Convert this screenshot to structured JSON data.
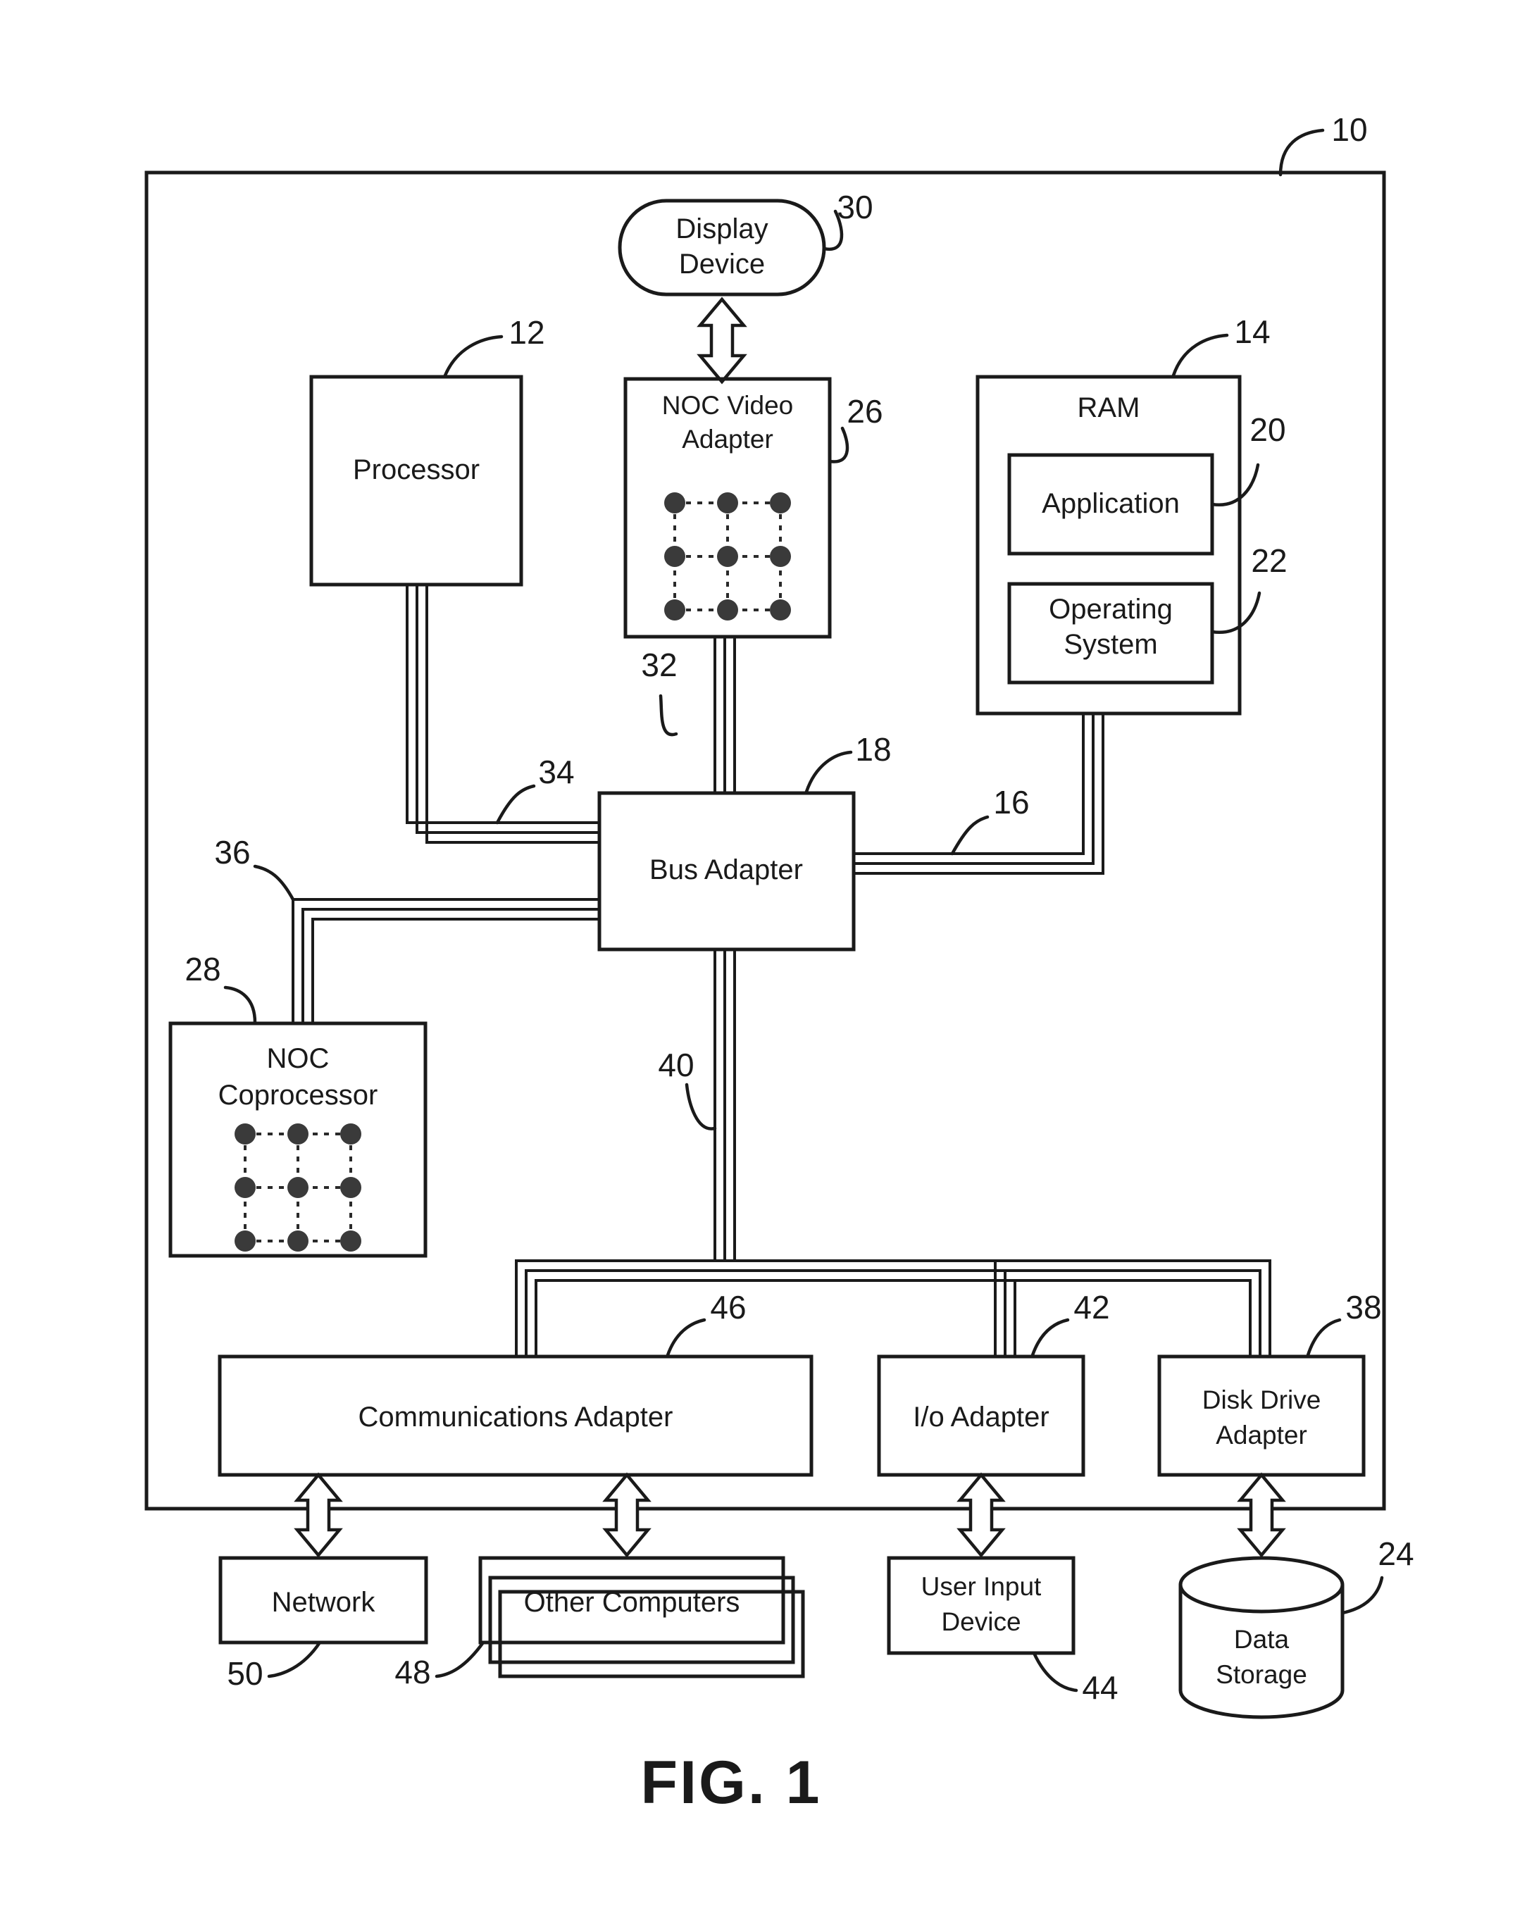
{
  "figure": {
    "caption": "FIG. 1",
    "outer_ref": "10"
  },
  "blocks": {
    "display_device": {
      "line1": "Display",
      "line2": "Device",
      "ref": "30"
    },
    "processor": {
      "line1": "Processor",
      "ref": "12"
    },
    "noc_video_adapter": {
      "line1": "NOC Video",
      "line2": "Adapter",
      "ref": "26"
    },
    "ram": {
      "line1": "RAM",
      "ref": "14"
    },
    "application": {
      "line1": "Application",
      "ref": "20"
    },
    "operating_system": {
      "line1": "Operating",
      "line2": "System",
      "ref": "22"
    },
    "bus_adapter": {
      "line1": "Bus Adapter",
      "ref": "18"
    },
    "noc_coprocessor": {
      "line1": "NOC",
      "line2": "Coprocessor",
      "ref": "28"
    },
    "communications_adapter": {
      "line1": "Communications Adapter",
      "ref": "46"
    },
    "io_adapter": {
      "line1": "I/o Adapter",
      "ref": "42"
    },
    "disk_drive_adapter": {
      "line1": "Disk Drive",
      "line2": "Adapter",
      "ref": "38"
    },
    "network": {
      "line1": "Network",
      "ref": "50"
    },
    "other_computers": {
      "line1": "Other Computers",
      "ref": "48"
    },
    "user_input_device": {
      "line1": "User Input",
      "line2": "Device",
      "ref": "44"
    },
    "data_storage": {
      "line1": "Data",
      "line2": "Storage",
      "ref": "24"
    }
  },
  "buses": {
    "front_side_bus_video": {
      "ref": "32"
    },
    "front_side_bus_processor": {
      "ref": "34"
    },
    "memory_bus": {
      "ref": "16"
    },
    "coprocessor_bus": {
      "ref": "36"
    },
    "expansion_bus": {
      "ref": "40"
    }
  },
  "mesh": {
    "rows": 3,
    "cols": 3,
    "description": "network-on-chip node mesh"
  },
  "colors": {
    "stroke": "#1a1a1a",
    "background": "#ffffff",
    "node_fill": "#3a3a3a"
  }
}
